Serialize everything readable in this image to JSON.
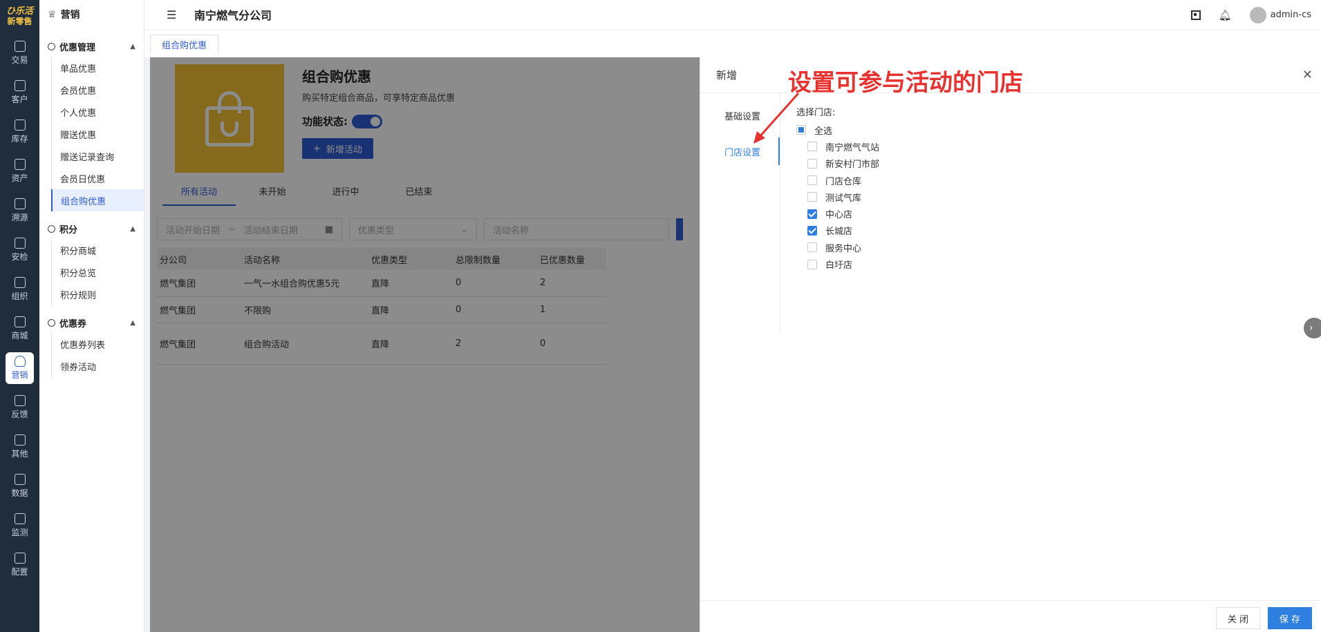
{
  "brand": {
    "line1": "ひ乐活",
    "line2": "新零售"
  },
  "rail": [
    {
      "label": "交易",
      "icon": "bag-icon"
    },
    {
      "label": "客户",
      "icon": "id-card-icon"
    },
    {
      "label": "库存",
      "icon": "list-icon"
    },
    {
      "label": "资产",
      "icon": "bulb-icon"
    },
    {
      "label": "溯源",
      "icon": "compass-icon"
    },
    {
      "label": "安检",
      "icon": "shield-icon"
    },
    {
      "label": "组织",
      "icon": "org-icon"
    },
    {
      "label": "商城",
      "icon": "store-icon"
    },
    {
      "label": "营销",
      "icon": "trophy-icon"
    },
    {
      "label": "反馈",
      "icon": "chat-icon"
    },
    {
      "label": "其他",
      "icon": "puzzle-icon"
    },
    {
      "label": "数据",
      "icon": "chart-icon"
    },
    {
      "label": "监测",
      "icon": "alarm-icon"
    },
    {
      "label": "配置",
      "icon": "grid-icon"
    }
  ],
  "sidebar": {
    "title": "营销",
    "groups": [
      {
        "label": "优惠管理",
        "items": [
          "单品优惠",
          "会员优惠",
          "个人优惠",
          "赠送优惠",
          "赠送记录查询",
          "会员日优惠",
          "组合购优惠"
        ]
      },
      {
        "label": "积分",
        "items": [
          "积分商城",
          "积分总览",
          "积分规则"
        ]
      },
      {
        "label": "优惠券",
        "items": [
          "优惠券列表",
          "领券活动"
        ]
      }
    ]
  },
  "topbar": {
    "company": "南宁燃气分公司",
    "user": "admin-cs"
  },
  "page_tab": "组合购优惠",
  "promo": {
    "title": "组合购优惠",
    "desc": "购买特定组合商品，可享特定商品优惠",
    "feature_label": "功能状态:",
    "add_button": "新增活动"
  },
  "tabs": [
    "所有活动",
    "未开始",
    "进行中",
    "已结束"
  ],
  "filters": {
    "start": "活动开始日期",
    "sep": "~",
    "end": "活动结束日期",
    "type": "优惠类型",
    "name": "活动名称"
  },
  "table": {
    "headers": [
      "分公司",
      "活动名称",
      "优惠类型",
      "总限制数量",
      "已优惠数量"
    ],
    "rows": [
      [
        "燃气集团",
        "一气一水组合购优惠5元",
        "直降",
        "0",
        "2"
      ],
      [
        "燃气集团",
        "不限购",
        "直降",
        "0",
        "1"
      ],
      [
        "燃气集团",
        "组合购活动",
        "直降",
        "2",
        "0"
      ]
    ]
  },
  "drawer": {
    "title": "新增",
    "nav": [
      "基础设置",
      "门店设置"
    ],
    "select_label": "选择门店:",
    "select_all": "全选",
    "stores": [
      {
        "name": "南宁燃气气站",
        "checked": false
      },
      {
        "name": "新安村门市部",
        "checked": false
      },
      {
        "name": "门店仓库",
        "checked": false
      },
      {
        "name": "测试气库",
        "checked": false
      },
      {
        "name": "中心店",
        "checked": true
      },
      {
        "name": "长城店",
        "checked": true
      },
      {
        "name": "服务中心",
        "checked": false
      },
      {
        "name": "白圩店",
        "checked": false
      }
    ],
    "close_button": "关 闭",
    "save_button": "保 存"
  },
  "annotation": "设置可参与活动的门店"
}
